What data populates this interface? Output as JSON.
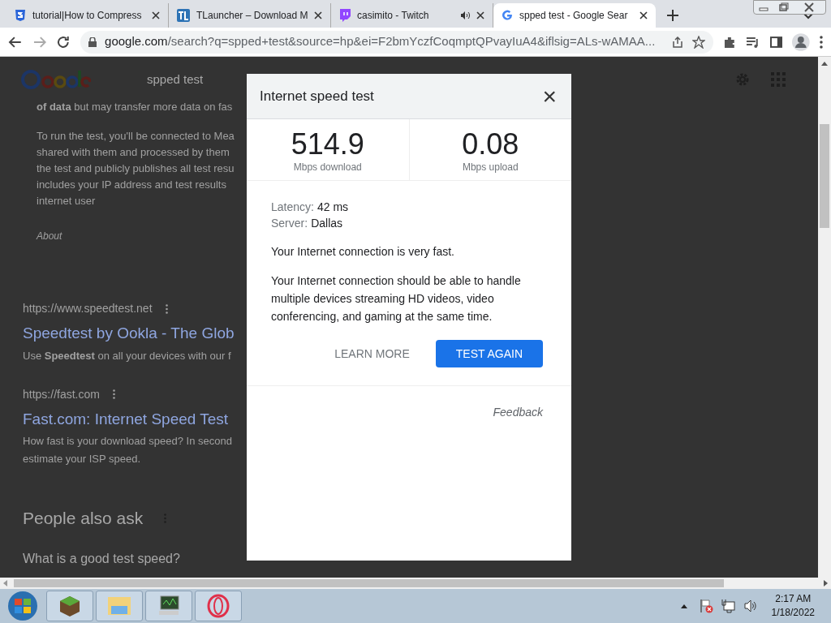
{
  "browser": {
    "tabs": [
      {
        "label": "tutorial|How to Compress",
        "selected": false,
        "audio": false
      },
      {
        "label": "TLauncher – Download M",
        "selected": false,
        "audio": false
      },
      {
        "label": "casimito - Twitch",
        "selected": false,
        "audio": true
      },
      {
        "label": "spped test - Google Sear",
        "selected": true,
        "audio": false
      }
    ],
    "url_host": "google.com",
    "url_rest": "/search?q=spped+test&source=hp&ei=F2bmYczfCoqmptQPvayIuA4&iflsig=ALs-wAMAA..."
  },
  "page": {
    "search_query": "spped test",
    "snippet_lead": "**of data** but may transfer more data on fas",
    "snippet_lines": [
      "To run the test, you'll be connected to Mea",
      "shared with them and processed by them",
      "the test and publicly publishes all test resu",
      "includes your IP address and test results",
      "internet user"
    ],
    "about": "About",
    "results": [
      {
        "url": "https://www.speedtest.net",
        "title": "Speedtest by Ookla - The Glob",
        "snippet_lines": [
          "Use **Speedtest** on all your devices with our f"
        ]
      },
      {
        "url": "https://fast.com",
        "title": "Fast.com: Internet Speed Test",
        "snippet_lines": [
          "How fast is your download speed? In second",
          "estimate your ISP speed."
        ]
      }
    ],
    "people_also_ask": {
      "heading": "People also ask",
      "questions": [
        "What is a good test speed?"
      ]
    }
  },
  "dialog": {
    "title": "Internet speed test",
    "close": "×",
    "metrics": [
      {
        "value": "514.9",
        "label": "Mbps download"
      },
      {
        "value": "0.08",
        "label": "Mbps upload"
      }
    ],
    "details": [
      {
        "label": "Latency:",
        "value": "42 ms"
      },
      {
        "label": "Server:",
        "value": "Dallas"
      }
    ],
    "summary": "Your Internet connection is very fast.",
    "description": "Your Internet connection should be able to handle multiple devices streaming HD videos, video conferencing, and gaming at the same time.",
    "buttons": [
      {
        "label": "LEARN MORE",
        "kind": "text"
      },
      {
        "label": "TEST AGAIN",
        "kind": "primary"
      }
    ],
    "feedback": "Feedback"
  },
  "taskbar": {
    "time": "2:17 AM",
    "date": "1/18/2022"
  }
}
